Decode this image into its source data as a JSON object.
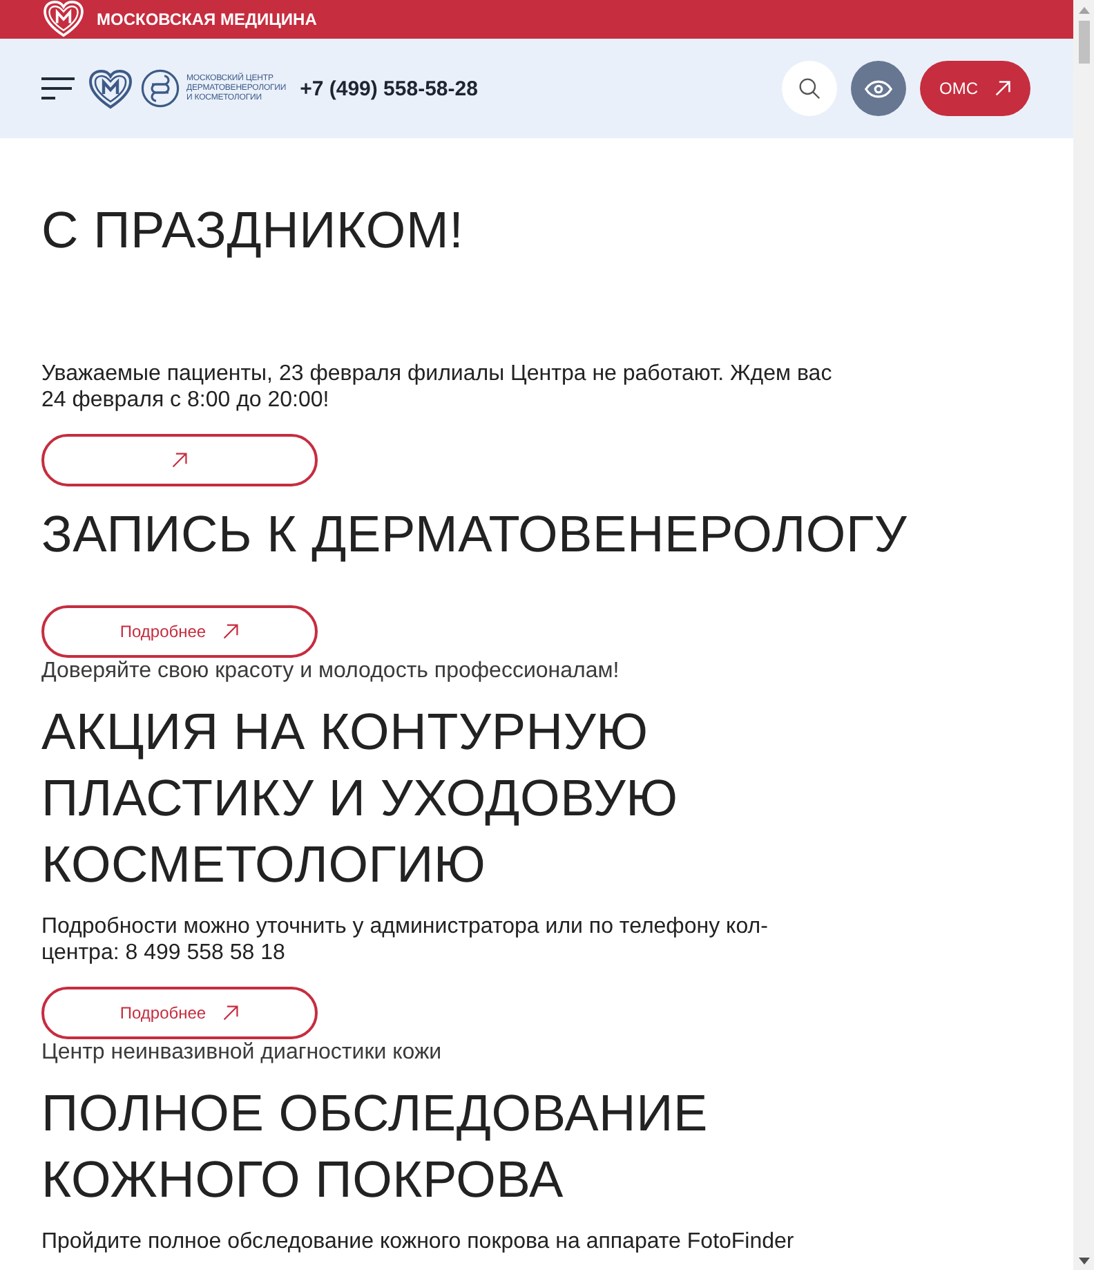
{
  "top_bar": {
    "brand": "МОСКОВСКАЯ МЕДИЦИНА"
  },
  "header": {
    "logo_text": [
      "МОСКОВСКИЙ ЦЕНТР",
      "ДЕРМАТОВЕНЕРОЛОГИИ",
      "И КОСМЕТОЛОГИИ"
    ],
    "phone": "+7 (499) 558-58-28",
    "oms_button": "ОМС"
  },
  "slides": [
    {
      "title": "С ПРАЗДНИКОМ!",
      "text": "Уважаемые пациенты, 23 февраля филиалы Центра не работают. Ждем вас 24 февраля с 8:00 до 20:00!",
      "button": {
        "kind": "icon"
      }
    },
    {
      "title": "ЗАПИСЬ К ДЕРМАТОВЕНЕРОЛОГУ",
      "button": {
        "kind": "text",
        "label": "Подробнее"
      }
    },
    {
      "subtitle": "Доверяйте свою красоту и молодость профессионалам!",
      "title": "АКЦИЯ НА КОНТУРНУЮ ПЛАСТИКУ И УХОДОВУЮ КОСМЕТОЛОГИЮ",
      "text": "Подробности можно уточнить у администратора или по телефону кол-центра: 8 499 558 58 18",
      "button": {
        "kind": "text",
        "label": "Подробнее"
      }
    },
    {
      "subtitle": "Центр неинвазивной диагностики кожи",
      "title": "ПОЛНОЕ ОБСЛЕДОВАНИЕ КОЖНОГО ПОКРОВА",
      "text": "Пройдите полное обследование кожного покрова на аппарате FotoFinder"
    }
  ]
}
